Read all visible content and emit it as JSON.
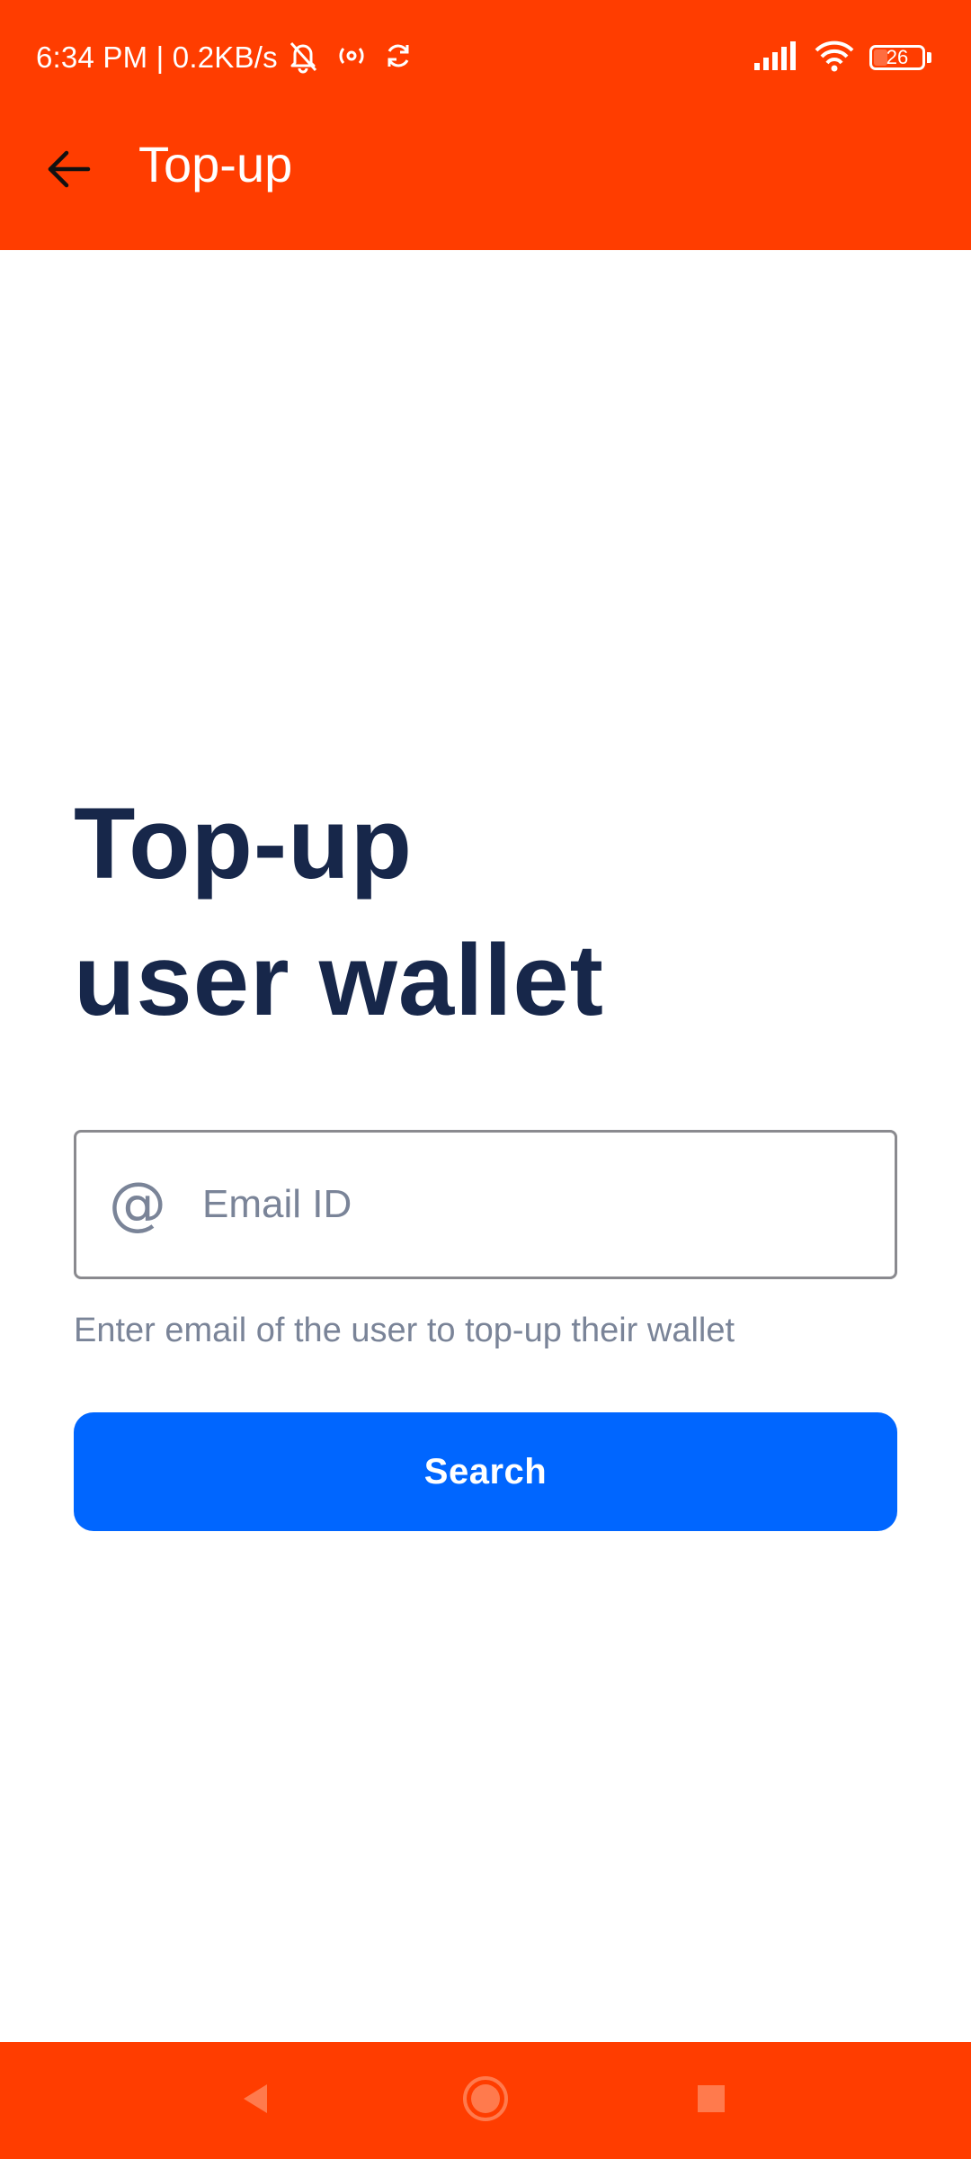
{
  "status_bar": {
    "time_text": "6:34 PM | 0.2KB/s",
    "battery_level": "26",
    "icons": [
      "muted-bell-icon",
      "hotspot-icon",
      "sync-icon",
      "signal-icon",
      "wifi-icon",
      "battery-icon"
    ]
  },
  "toolbar": {
    "back_icon": "arrow-left-icon",
    "title": "Top-up"
  },
  "main": {
    "headline_line1": "Top-up",
    "headline_line2": "user wallet",
    "email_field": {
      "icon": "at-sign-icon",
      "placeholder": "Email ID",
      "value": ""
    },
    "helper_text": "Enter email of the user to top-up their wallet",
    "search_label": "Search"
  },
  "nav_bar": {
    "buttons": [
      "back-triangle-icon",
      "home-circle-icon",
      "recents-square-icon"
    ]
  },
  "colors": {
    "brand_orange": "#FF3D00",
    "primary_blue": "#0066FF",
    "headline_navy": "#17274A",
    "muted_gray": "#7A8498"
  }
}
